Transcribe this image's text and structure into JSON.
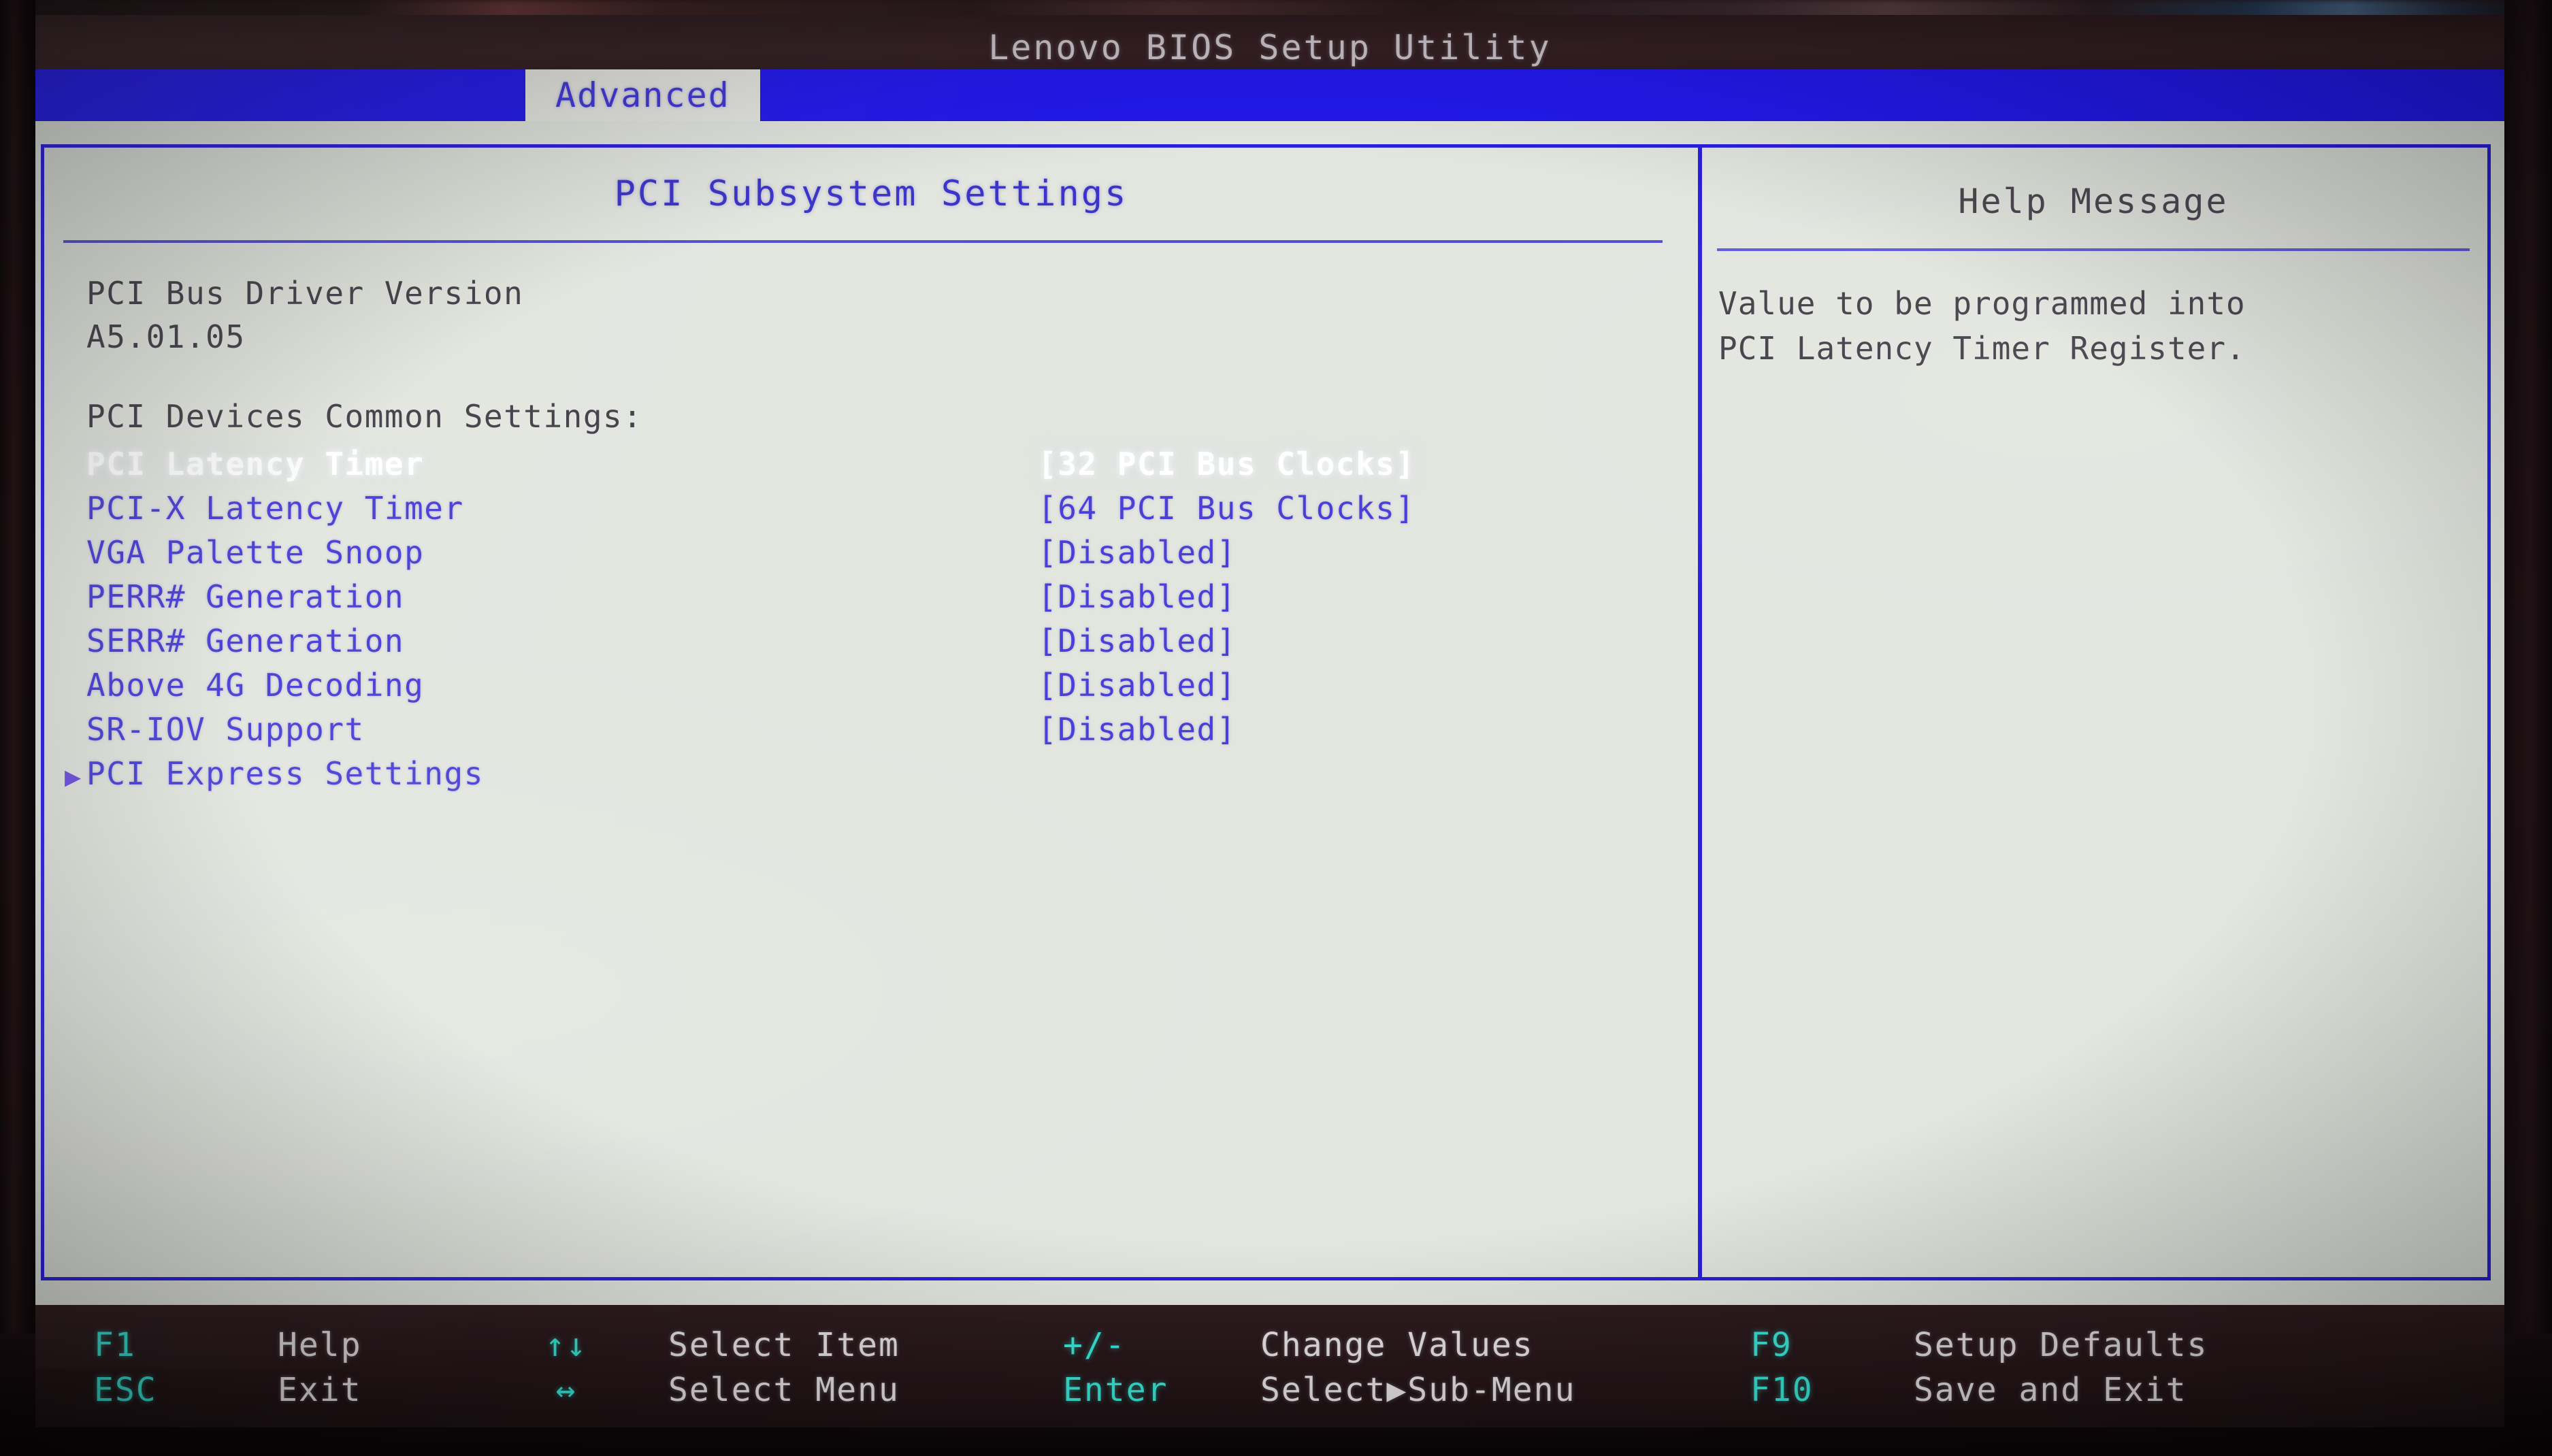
{
  "window": {
    "title": "Lenovo BIOS Setup Utility"
  },
  "menubar": {
    "tabs": [
      {
        "label": "Advanced",
        "active": true
      }
    ]
  },
  "main": {
    "section_title": "PCI Subsystem Settings",
    "info": [
      "PCI Bus Driver Version",
      "A5.01.05"
    ],
    "group_heading": "PCI Devices Common Settings:",
    "rows": [
      {
        "label": "PCI Latency Timer",
        "value": "[32 PCI Bus Clocks]",
        "selected": true,
        "submenu": false
      },
      {
        "label": "PCI-X Latency Timer",
        "value": "[64 PCI Bus Clocks]",
        "selected": false,
        "submenu": false
      },
      {
        "label": "VGA Palette Snoop",
        "value": "[Disabled]",
        "selected": false,
        "submenu": false
      },
      {
        "label": "PERR# Generation",
        "value": "[Disabled]",
        "selected": false,
        "submenu": false
      },
      {
        "label": "SERR# Generation",
        "value": "[Disabled]",
        "selected": false,
        "submenu": false
      },
      {
        "label": "Above 4G Decoding",
        "value": "[Disabled]",
        "selected": false,
        "submenu": false
      },
      {
        "label": "SR-IOV Support",
        "value": "[Disabled]",
        "selected": false,
        "submenu": false
      },
      {
        "label": "PCI Express Settings",
        "value": "",
        "selected": false,
        "submenu": true
      }
    ]
  },
  "help": {
    "title": "Help Message",
    "lines": [
      "Value to be programmed into",
      "PCI Latency Timer Register."
    ]
  },
  "statusbar": {
    "row1": {
      "key": "F1",
      "desc": "Help",
      "arrow_icon": "↑↓",
      "desc2": "Select Item",
      "key2": "+/-",
      "desc3": "Change Values",
      "key3": "F9",
      "desc4": "Setup Defaults"
    },
    "row2": {
      "key": "ESC",
      "desc": "Exit",
      "arrow_icon": "↔",
      "desc2": "Select Menu",
      "key2": "Enter",
      "desc3": "Select▶Sub-Menu",
      "key3": "F10",
      "desc4": "Save and Exit"
    }
  },
  "colors": {
    "menubar_blue": "#2219ee",
    "screen_bg": "#e3e6df",
    "option_blue": "#4a3fd6",
    "selected_white": "#ffffff",
    "help_text": "#44404a",
    "status_key_cyan": "#39e8d8",
    "frame_blue": "#2a1fe0"
  }
}
